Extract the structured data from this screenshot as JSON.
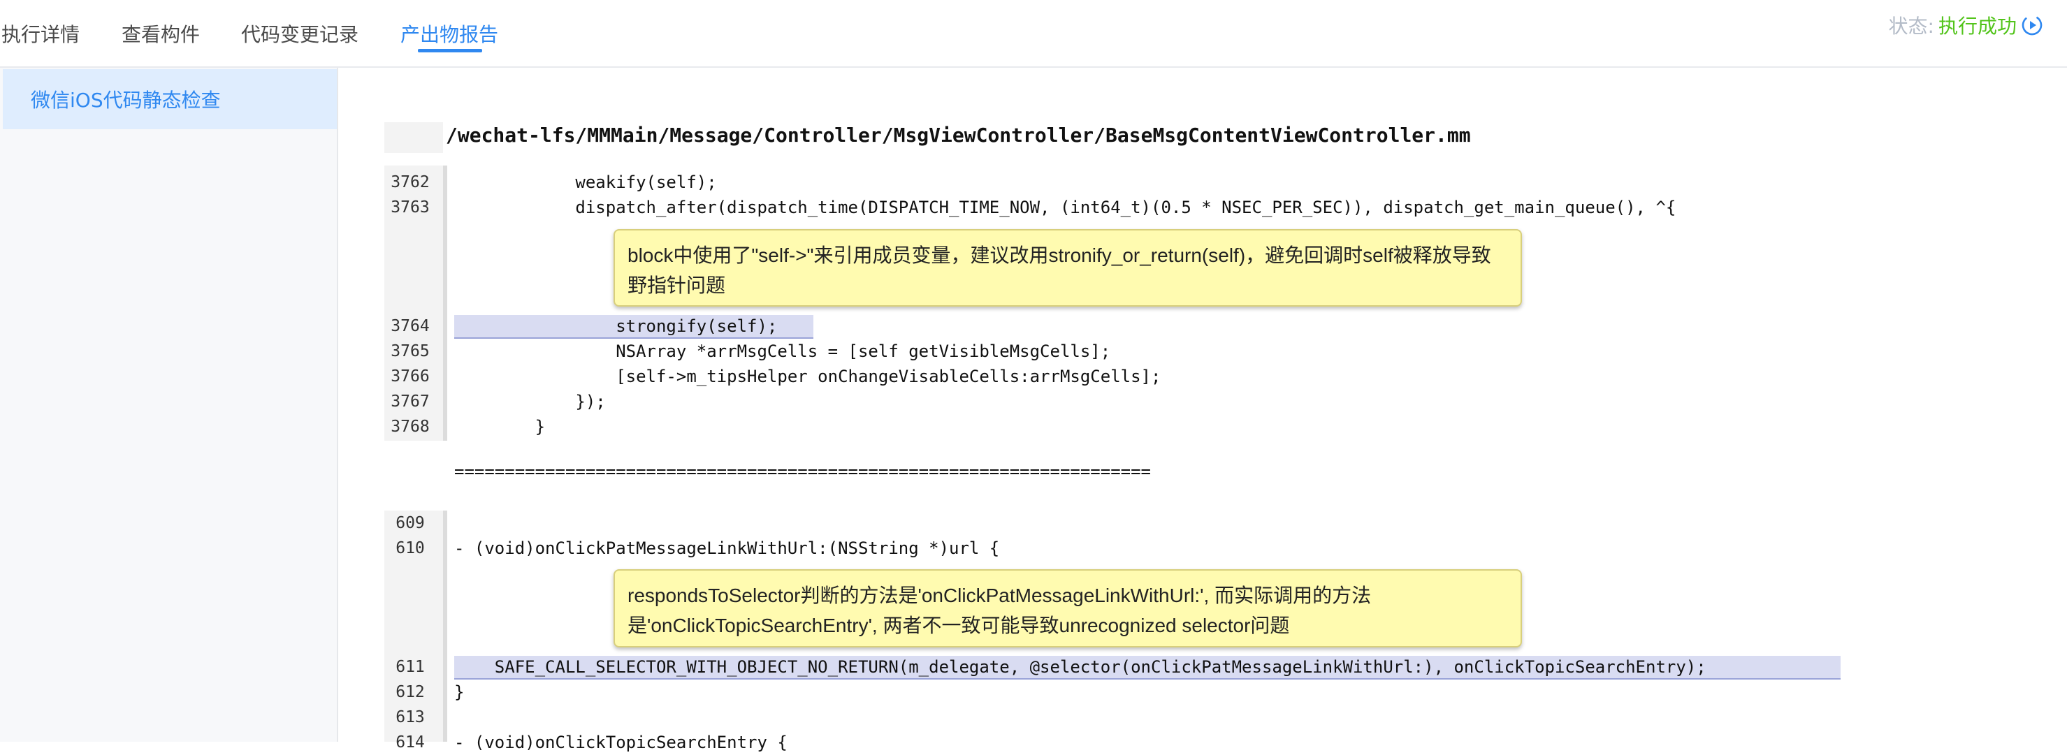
{
  "tabs": [
    {
      "label": "执行详情",
      "active": false
    },
    {
      "label": "查看构件",
      "active": false
    },
    {
      "label": "代码变更记录",
      "active": false
    },
    {
      "label": "产出物报告",
      "active": true
    }
  ],
  "status": {
    "label": "状态:",
    "value": "执行成功",
    "icon": "play-circle-icon",
    "color": "#52c41a"
  },
  "sidebar": {
    "items": [
      {
        "label": "微信iOS代码静态检查",
        "selected": true
      }
    ]
  },
  "report": {
    "file_path": "/wechat-lfs/MMMain/Message/Controller/MsgViewController/BaseMsgContentViewController.mm",
    "block1": {
      "lines": [
        {
          "no": "3762",
          "code": "            weakify(self);"
        },
        {
          "no": "3763",
          "code": "            dispatch_after(dispatch_time(DISPATCH_TIME_NOW, (int64_t)(0.5 * NSEC_PER_SEC)), dispatch_get_main_queue(), ^{"
        },
        {
          "no": "3764",
          "code": "                strongify(self);",
          "highlight": true
        },
        {
          "no": "3765",
          "code": "                NSArray *arrMsgCells = [self getVisibleMsgCells];"
        },
        {
          "no": "3766",
          "code": "                [self->m_tipsHelper onChangeVisableCells:arrMsgCells];"
        },
        {
          "no": "3767",
          "code": "            });"
        },
        {
          "no": "3768",
          "code": "        }"
        }
      ],
      "note": "block中使用了\"self->\"来引用成员变量，建议改用stronify_or_return(self)，避免回调时self被释放导致野指针问题"
    },
    "separator": "=====================================================================",
    "block2": {
      "lines": [
        {
          "no": "609",
          "code": ""
        },
        {
          "no": "610",
          "code": "- (void)onClickPatMessageLinkWithUrl:(NSString *)url {"
        },
        {
          "no": "611",
          "code": "    SAFE_CALL_SELECTOR_WITH_OBJECT_NO_RETURN(m_delegate, @selector(onClickPatMessageLinkWithUrl:), onClickTopicSearchEntry);",
          "highlight": true
        },
        {
          "no": "612",
          "code": "}"
        },
        {
          "no": "613",
          "code": ""
        },
        {
          "no": "614",
          "code": "- (void)onClickTopicSearchEntry {"
        }
      ],
      "note": "respondsToSelector判断的方法是'onClickPatMessageLinkWithUrl:', 而实际调用的方法是'onClickTopicSearchEntry', 两者不一致可能导致unrecognized selector问题"
    }
  }
}
